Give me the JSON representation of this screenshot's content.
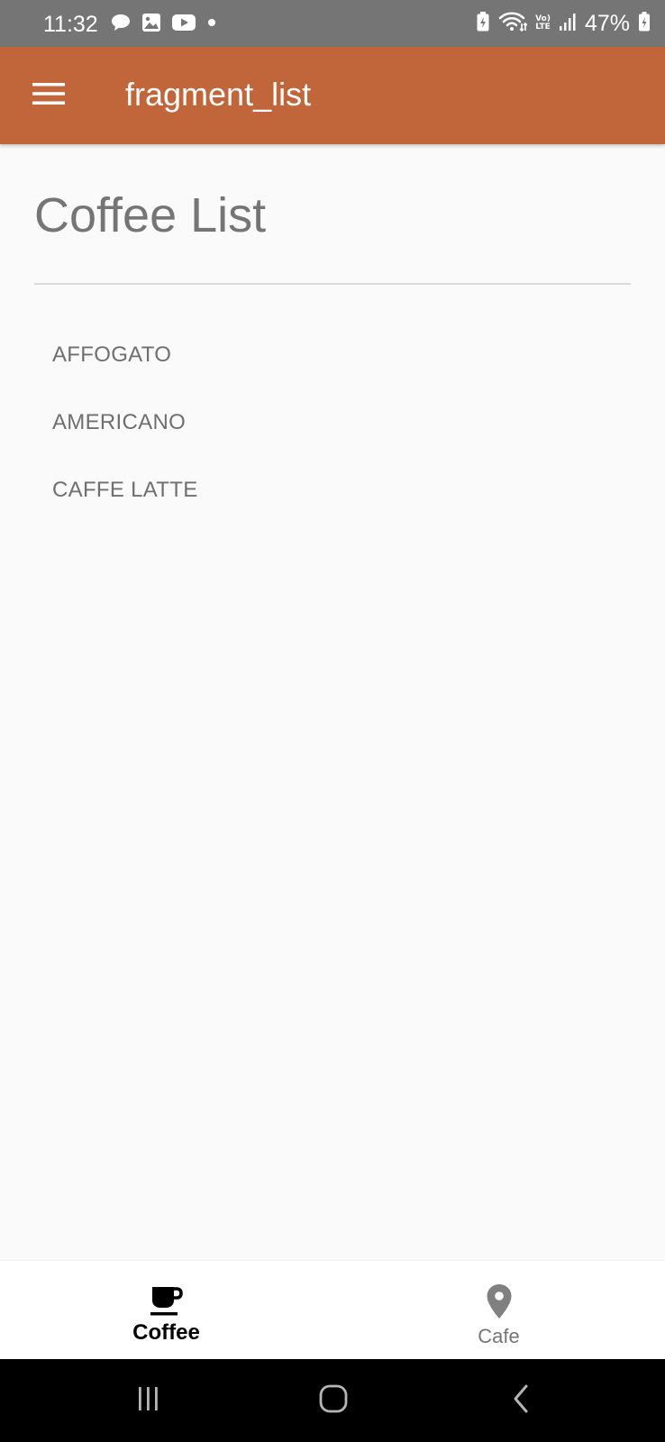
{
  "status_bar": {
    "time": "11:32",
    "battery_percent": "47%",
    "left_icons": [
      "chat-bubble-icon",
      "image-icon",
      "youtube-icon",
      "notification-dot-icon"
    ],
    "right_icons": [
      "battery-saver-icon",
      "wifi-icon",
      "volte-lte-icon",
      "signal-icon",
      "battery-charging-icon"
    ],
    "lte_top": "Vo)",
    "lte_bottom": "LTE"
  },
  "app_bar": {
    "title": "fragment_list",
    "menu_icon": "hamburger-menu-icon",
    "background_color": "#C1663A"
  },
  "main": {
    "heading": "Coffee List",
    "items": [
      "AFFOGATO",
      "AMERICANO",
      "CAFFE LATTE"
    ]
  },
  "bottom_nav": {
    "tabs": [
      {
        "label": "Coffee",
        "icon": "coffee-cup-icon",
        "selected": true
      },
      {
        "label": "Cafe",
        "icon": "location-pin-icon",
        "selected": false
      }
    ]
  },
  "system_nav": {
    "buttons": [
      "recent-apps-icon",
      "home-icon",
      "back-icon"
    ]
  }
}
